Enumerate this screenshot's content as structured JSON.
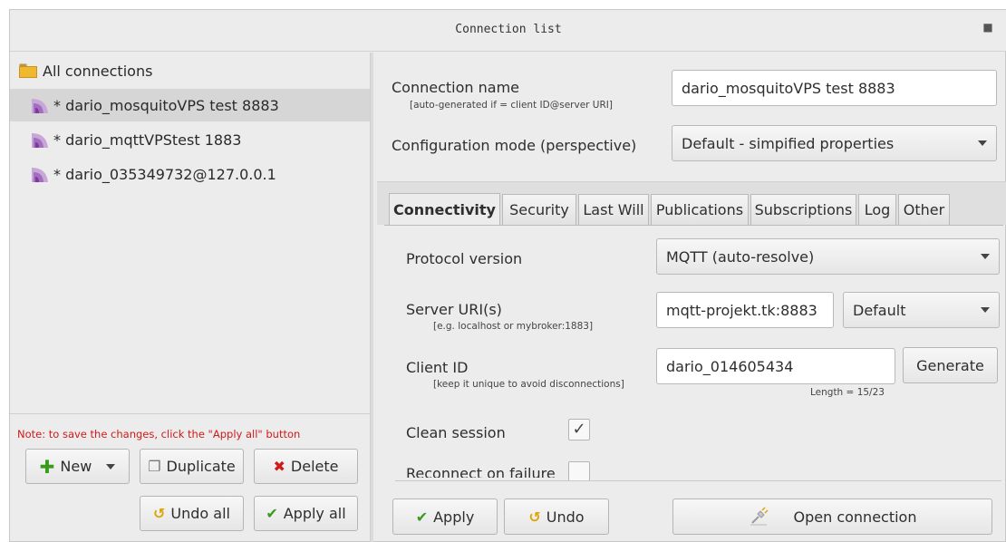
{
  "window": {
    "title": "Connection list"
  },
  "sidebar": {
    "root_label": "All connections",
    "items": [
      {
        "label": "* dario_mosquitoVPS test 8883",
        "selected": true
      },
      {
        "label": "* dario_mqttVPStest 1883",
        "selected": false
      },
      {
        "label": "* dario_035349732@127.0.0.1",
        "selected": false
      }
    ],
    "note": "Note: to save the changes, click the \"Apply all\" button",
    "buttons": {
      "new": "New",
      "duplicate": "Duplicate",
      "delete": "Delete",
      "undo_all": "Undo all",
      "apply_all": "Apply all"
    }
  },
  "form": {
    "connection_name": {
      "label": "Connection name",
      "hint": "[auto-generated if = client ID@server URI]",
      "value": "dario_mosquitoVPS test 8883"
    },
    "configuration_mode": {
      "label": "Configuration mode (perspective)",
      "value": "Default - simpified properties"
    }
  },
  "tabs": [
    "Connectivity",
    "Security",
    "Last Will",
    "Publications",
    "Subscriptions",
    "Log",
    "Other"
  ],
  "connectivity": {
    "protocol_version": {
      "label": "Protocol version",
      "value": "MQTT (auto-resolve)"
    },
    "server_uri": {
      "label": "Server URI(s)",
      "hint": "[e.g. localhost or mybroker:1883]",
      "value": "mqtt-projekt.tk:8883",
      "port_mode": "Default"
    },
    "client_id": {
      "label": "Client ID",
      "hint": "[keep it unique to avoid disconnections]",
      "value": "dario_014605434",
      "generate_label": "Generate",
      "length_text": "Length = 15/23"
    },
    "clean_session": {
      "label": "Clean session",
      "checked": true,
      "mark": "✓"
    },
    "reconnect": {
      "label": "Reconnect on failure",
      "checked": false
    }
  },
  "actions": {
    "apply": "Apply",
    "undo": "Undo",
    "open_connection": "Open connection"
  },
  "icons": {
    "folder": "folder-icon",
    "connection": "wifi-signal-icon",
    "add": "plus-icon",
    "duplicate": "copy-icon",
    "delete": "x-icon",
    "undo": "undo-arrow-icon",
    "apply": "checkmark-icon",
    "open": "plug-icon"
  },
  "colors": {
    "accent_green": "#3a9a1c",
    "delete_red": "#d01a1a",
    "note_red": "#d01a1a",
    "undo_orange": "#e0a400",
    "connection_icon": "#8a3fa8"
  }
}
